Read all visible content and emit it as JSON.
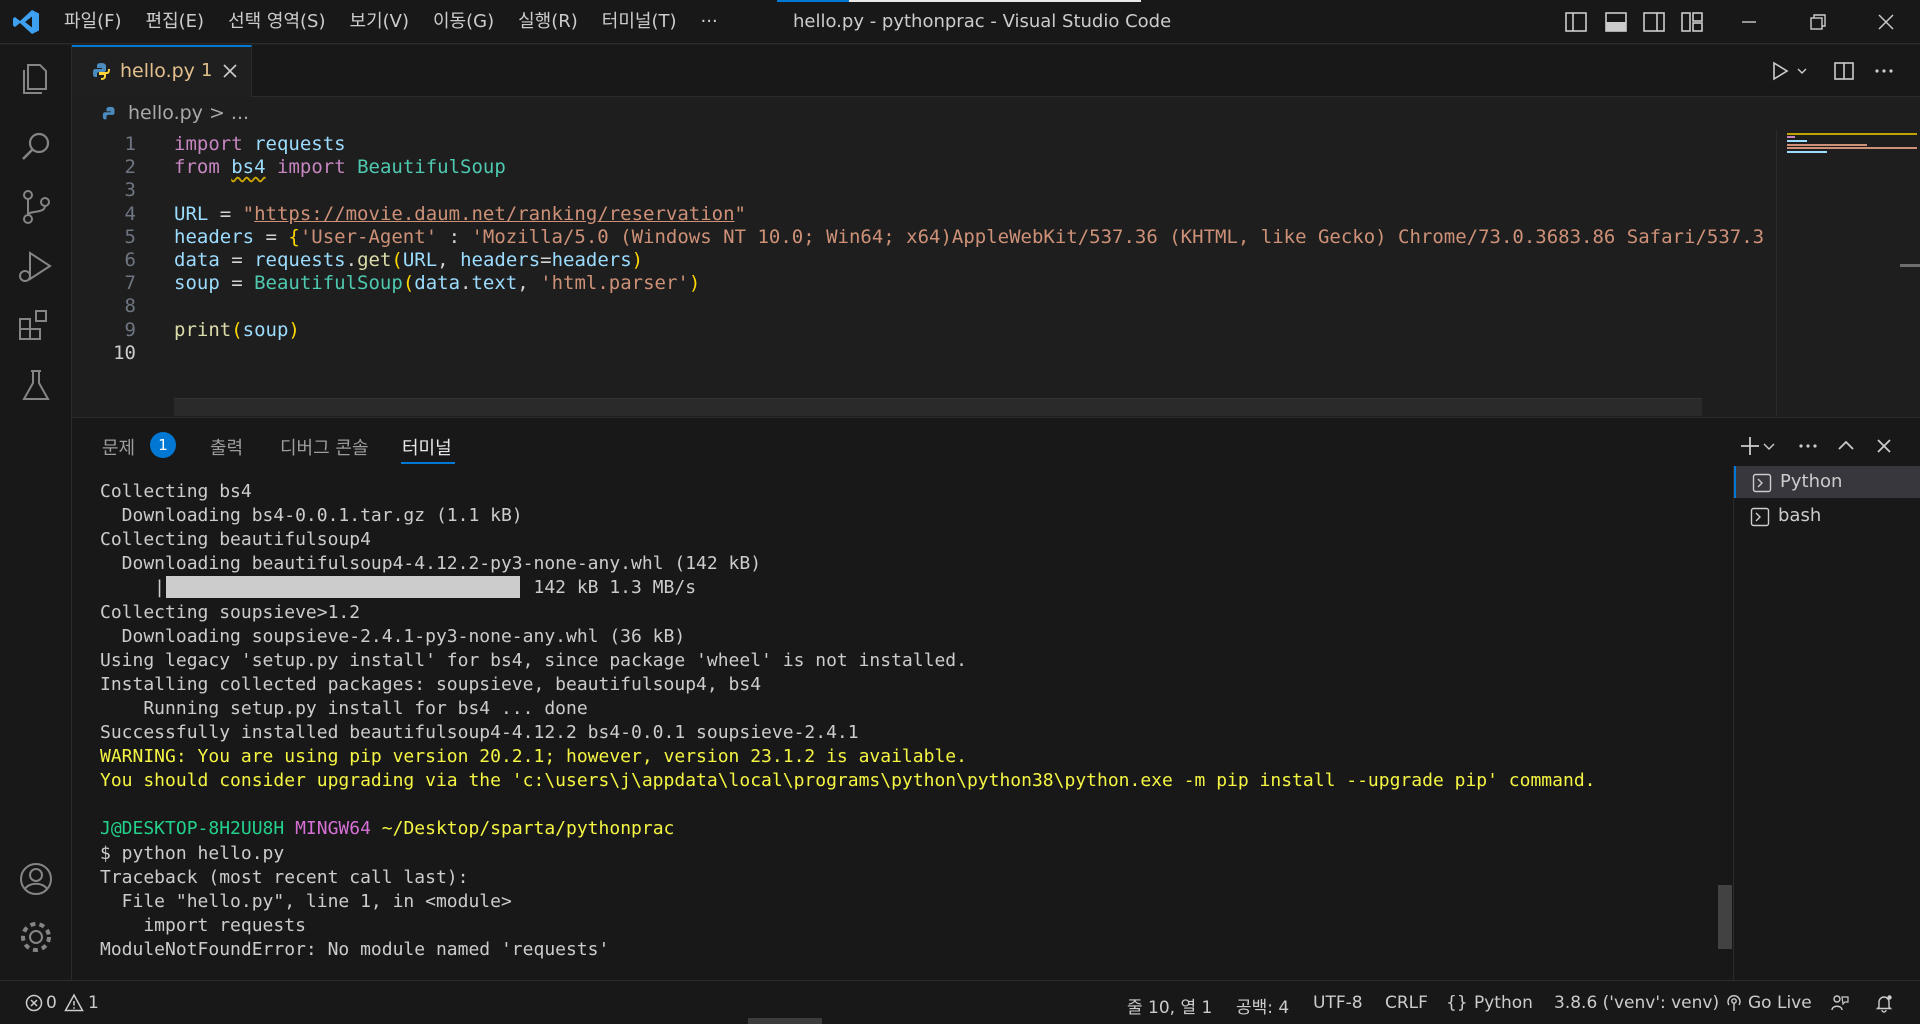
{
  "titlebar": {
    "menu": [
      "파일(F)",
      "편집(E)",
      "선택 영역(S)",
      "보기(V)",
      "이동(G)",
      "실행(R)",
      "터미널(T)",
      "···"
    ],
    "window_title": "hello.py - pythonprac - Visual Studio Code"
  },
  "editor": {
    "tab": {
      "name": "hello.py",
      "problem_count": "1"
    },
    "breadcrumb": "hello.py > ...",
    "lines": [
      {
        "n": "1",
        "parts": [
          [
            "kw",
            "import"
          ],
          [
            "op",
            " "
          ],
          [
            "id",
            "requests"
          ]
        ]
      },
      {
        "n": "2",
        "parts": [
          [
            "kw",
            "from"
          ],
          [
            "op",
            " "
          ],
          [
            "squig",
            "bs4"
          ],
          [
            "op",
            " "
          ],
          [
            "kw",
            "import"
          ],
          [
            "op",
            " "
          ],
          [
            "cls",
            "BeautifulSoup"
          ]
        ]
      },
      {
        "n": "3",
        "parts": []
      },
      {
        "n": "4",
        "parts": [
          [
            "id",
            "URL"
          ],
          [
            "op",
            " = "
          ],
          [
            "str",
            "\""
          ],
          [
            "urlstr",
            "https://movie.daum.net/ranking/reservation"
          ],
          [
            "str",
            "\""
          ]
        ]
      },
      {
        "n": "5",
        "parts": [
          [
            "id",
            "headers"
          ],
          [
            "op",
            " = "
          ],
          [
            "br",
            "{"
          ],
          [
            "str",
            "'User-Agent'"
          ],
          [
            "op",
            " : "
          ],
          [
            "str",
            "'Mozilla/5.0 (Windows NT 10.0; Win64; x64)AppleWebKit/537.36 (KHTML, like Gecko) Chrome/73.0.3683.86 Safari/537.3"
          ]
        ]
      },
      {
        "n": "6",
        "parts": [
          [
            "id",
            "data"
          ],
          [
            "op",
            " = "
          ],
          [
            "id",
            "requests"
          ],
          [
            "op",
            "."
          ],
          [
            "fn",
            "get"
          ],
          [
            "br",
            "("
          ],
          [
            "id",
            "URL"
          ],
          [
            "op",
            ", "
          ],
          [
            "id",
            "headers"
          ],
          [
            "op",
            "="
          ],
          [
            "id",
            "headers"
          ],
          [
            "br",
            ")"
          ]
        ]
      },
      {
        "n": "7",
        "parts": [
          [
            "id",
            "soup"
          ],
          [
            "op",
            " = "
          ],
          [
            "cls",
            "BeautifulSoup"
          ],
          [
            "br",
            "("
          ],
          [
            "id",
            "data"
          ],
          [
            "op",
            "."
          ],
          [
            "id",
            "text"
          ],
          [
            "op",
            ", "
          ],
          [
            "str",
            "'html.parser'"
          ],
          [
            "br",
            ")"
          ]
        ]
      },
      {
        "n": "8",
        "parts": []
      },
      {
        "n": "9",
        "parts": [
          [
            "fn",
            "print"
          ],
          [
            "br",
            "("
          ],
          [
            "id",
            "soup"
          ],
          [
            "br",
            ")"
          ]
        ]
      },
      {
        "n": "10",
        "parts": []
      }
    ]
  },
  "panel": {
    "tabs": [
      "문제",
      "출력",
      "디버그 콘솔",
      "터미널"
    ],
    "problems_badge": "1",
    "active_tab": "터미널",
    "terminal_lines": [
      {
        "t": "Collecting bs4"
      },
      {
        "t": "  Downloading bs4-0.0.1.tar.gz (1.1 kB)"
      },
      {
        "t": "Collecting beautifulsoup4"
      },
      {
        "t": "  Downloading beautifulsoup4-4.12.2-py3-none-any.whl (142 kB)"
      },
      {
        "t": "     |                                | 142 kB 1.3 MB/s"
      },
      {
        "t": "Collecting soupsieve>1.2"
      },
      {
        "t": "  Downloading soupsieve-2.4.1-py3-none-any.whl (36 kB)"
      },
      {
        "t": "Using legacy 'setup.py install' for bs4, since package 'wheel' is not installed."
      },
      {
        "t": "Installing collected packages: soupsieve, beautifulsoup4, bs4"
      },
      {
        "t": "    Running setup.py install for bs4 ... done"
      },
      {
        "t": "Successfully installed beautifulsoup4-4.12.2 bs4-0.0.1 soupsieve-2.4.1"
      },
      {
        "t": "WARNING: You are using pip version 20.2.1; however, version 23.1.2 is available.",
        "warn": true
      },
      {
        "t": "You should consider upgrading via the 'c:\\users\\j\\appdata\\local\\programs\\python\\python38\\python.exe -m pip install --upgrade pip' command.",
        "warn": true
      },
      {
        "t": ""
      },
      {
        "prompt": true
      },
      {
        "t": "$ python hello.py"
      },
      {
        "t": "Traceback (most recent call last):"
      },
      {
        "t": "  File \"hello.py\", line 1, in <module>"
      },
      {
        "t": "    import requests"
      },
      {
        "t": "ModuleNotFoundError: No module named 'requests'"
      }
    ],
    "prompt": {
      "user": "J@DESKTOP-8H2UU8H",
      "shell": "MINGW64",
      "path": "~/Desktop/sparta/pythonprac"
    },
    "download_progress": 1.0,
    "terminals": [
      "Python",
      "bash"
    ]
  },
  "statusbar": {
    "errors": "0",
    "warnings": "1",
    "cursor": "줄 10, 열 1",
    "indent": "공백: 4",
    "encoding": "UTF-8",
    "eol": "CRLF",
    "language": "Python",
    "interpreter": "3.8.6 ('venv': venv)",
    "golive": "Go Live"
  },
  "colors": {
    "accent": "#0078d4",
    "modified_tab": "#e2c08d",
    "warning_text": "#f5f543",
    "prompt_user": "#23d18b",
    "prompt_shell": "#d670d6"
  }
}
